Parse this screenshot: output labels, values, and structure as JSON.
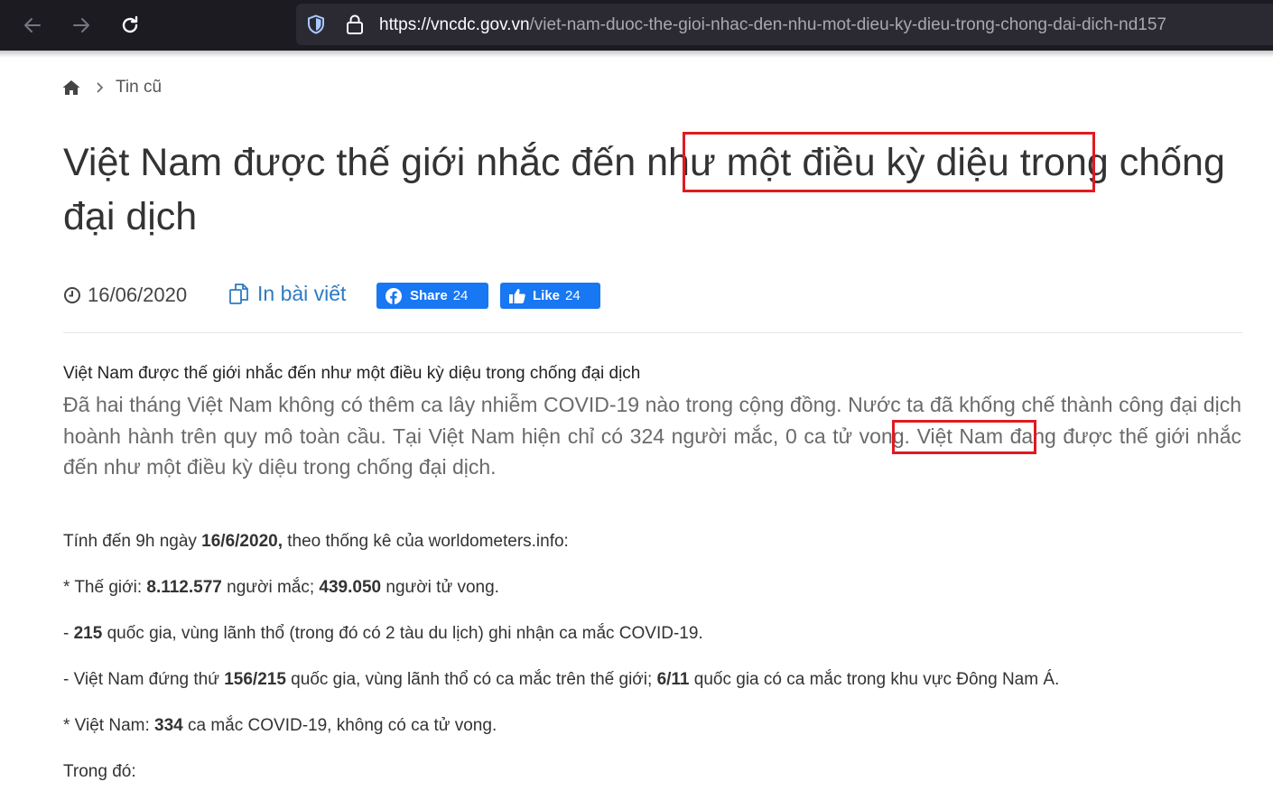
{
  "browser": {
    "url_domain": "https://vncdc.gov.vn",
    "url_path": "/viet-nam-duoc-the-gioi-nhac-den-nhu-mot-dieu-ky-dieu-trong-chong-dai-dich-nd157"
  },
  "breadcrumb": {
    "home_icon": "home-icon",
    "separator_icon": "chevron-right-icon",
    "section": "Tin cũ"
  },
  "article": {
    "title_before": "Việt Nam được thế giới nhắc đến ",
    "title_highlight": "như một điều kỳ diệu",
    "title_after": " trong chống đại dịch",
    "date": "16/06/2020",
    "print_label": "In bài viết",
    "share_label": "Share",
    "share_count": "24",
    "like_label": "Like",
    "like_count": "24",
    "caption": "Việt Nam được thế giới nhắc đến như một điều kỳ diệu trong chống đại dịch",
    "summary_before": "Đã hai tháng Việt Nam không có thêm ca lây nhiễm COVID-19 nào trong cộng đồng. Nước ta đã khống chế thành công đại dịch hoành hành trên quy mô toàn cầu. Tại Việt Nam hiện chỉ có 324 người mắc, ",
    "summary_highlight": "0 ca tử vong.",
    "summary_after": " Việt Nam đang được thế giới nhắc đến như một điều kỳ diệu trong chống đại dịch.",
    "p1": {
      "a": "Tính đến 9h ngày ",
      "b": "16/6/2020,",
      "c": " theo thống kê của worldometers.info:"
    },
    "p2": {
      "a": "* Thế giới: ",
      "b": "8.112.577",
      "c": " người mắc; ",
      "d": "439.050",
      "e": " người tử vong."
    },
    "p3": {
      "a": "- ",
      "b": "215",
      "c": " quốc gia, vùng lãnh thổ (trong đó có 2 tàu du lịch) ghi nhận ca mắc COVID-19."
    },
    "p4": {
      "a": "- Việt Nam đứng thứ ",
      "b": "156/215",
      "c": " quốc gia, vùng lãnh thổ có ca mắc trên thế giới; ",
      "d": "6/11",
      "e": " quốc gia có ca mắc trong khu vực Đông Nam Á."
    },
    "p5": {
      "a": "* Việt Nam: ",
      "b": "334",
      "c": " ca mắc COVID-19, không có ca tử vong."
    },
    "p6": "Trong đó:"
  },
  "colors": {
    "highlight_border": "#e01a22",
    "link_blue": "#2d7bc4",
    "facebook_blue": "#1877f2",
    "chrome_dark": "#1c1b22"
  }
}
